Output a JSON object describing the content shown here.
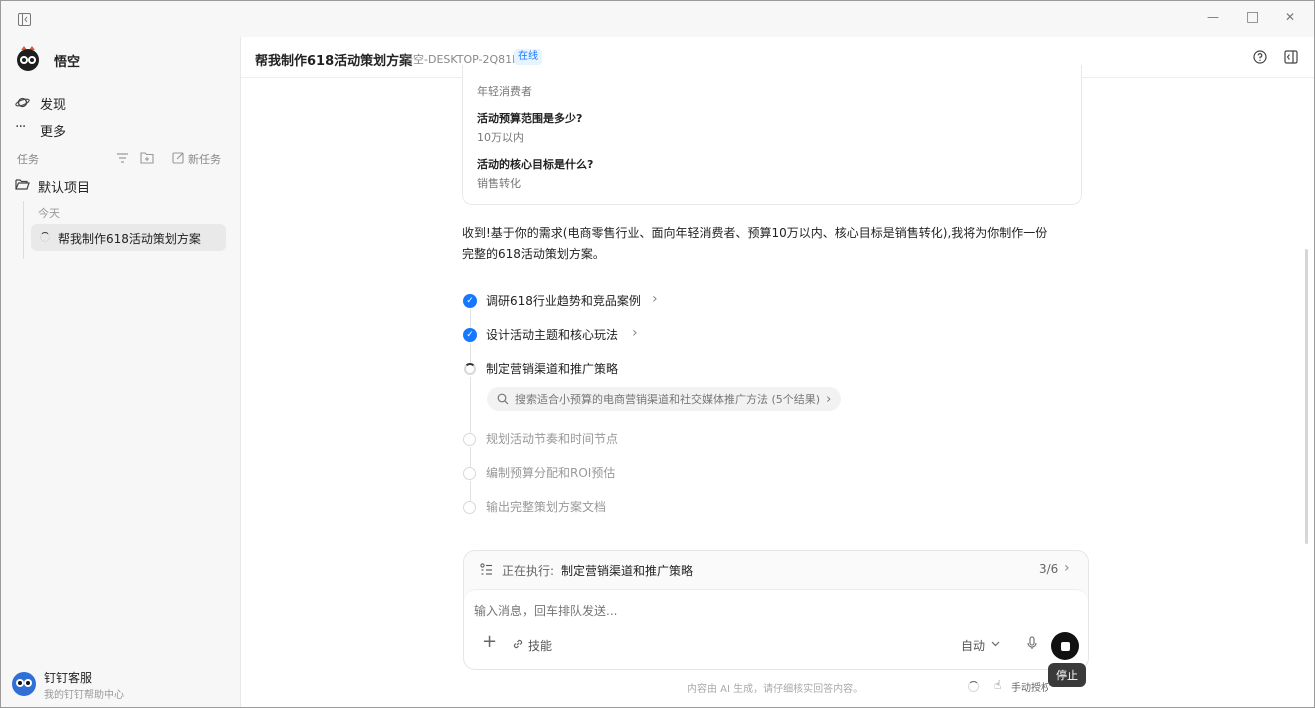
{
  "window": {
    "minimize_glyph": "—",
    "maximize_glyph": "□",
    "close_glyph": "✕"
  },
  "sidebar": {
    "app_name": "悟空",
    "nav": [
      {
        "label": "发现",
        "icon": "planet-icon"
      },
      {
        "label": "更多",
        "icon": "more-icon"
      }
    ],
    "tasks_section": "任务",
    "new_task_label": "新任务",
    "project_name": "默认项目",
    "today_label": "今天",
    "active_task": "帮我制作618活动策划方案",
    "user": {
      "name": "钉钉客服",
      "subtitle": "我的钉钉帮助中心"
    }
  },
  "header": {
    "title": "帮我制作618活动策划方案",
    "device": "悟空-DESKTOP-2Q81H6I",
    "status": "在线"
  },
  "qa_card": {
    "first_answer": "年轻消费者",
    "items": [
      {
        "question": "活动预算范围是多少?",
        "answer": "10万以内"
      },
      {
        "question": "活动的核心目标是什么?",
        "answer": "销售转化"
      }
    ]
  },
  "reply": {
    "line1": "收到!基于你的需求(电商零售行业、面向年轻消费者、预算10万以内、核心目标是销售转化),我将为你制作一份",
    "line2": "完整的618活动策划方案。"
  },
  "steps": [
    {
      "label": "调研618行业趋势和竞品案例",
      "status": "done",
      "chevron": "›"
    },
    {
      "label": "设计活动主题和核心玩法",
      "status": "done",
      "chevron": "›"
    },
    {
      "label": "制定营销渠道和推广策略",
      "status": "running"
    },
    {
      "label": "规划活动节奏和时间节点",
      "status": "pending"
    },
    {
      "label": "编制预算分配和ROI预估",
      "status": "pending"
    },
    {
      "label": "输出完整策划方案文档",
      "status": "pending"
    }
  ],
  "search_pill": {
    "text": "搜索适合小预算的电商营销渠道和社交媒体推广方法 (5个结果)",
    "chevron": "›"
  },
  "executing": {
    "prefix": "正在执行:",
    "task": "制定营销渠道和推广策略",
    "progress": "3/6",
    "chevron": "›"
  },
  "composer": {
    "placeholder": "输入消息，回车排队发送...",
    "add_glyph": "+",
    "skills_label": "技能",
    "mode_label": "自动",
    "stop_tooltip": "停止"
  },
  "footer": {
    "disclaimer": "内容由 AI 生成，请仔细核实回答内容。",
    "manual_auth": "手动授权"
  },
  "colors": {
    "accent": "#1677ff",
    "status_badge_bg": "#e6f4ff",
    "status_badge_text": "#1677ff"
  }
}
